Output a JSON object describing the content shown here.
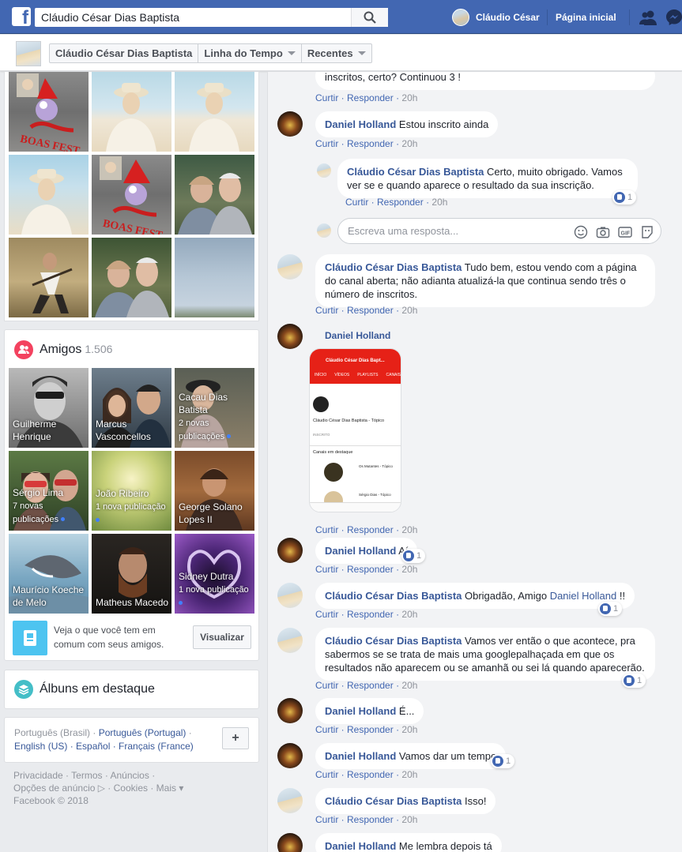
{
  "topbar": {
    "logo": "f",
    "search_value": "Cláudio César Dias Baptista",
    "user_name": "Cláudio César",
    "home_label": "Página inicial"
  },
  "subbar": {
    "crumbs": [
      "Cláudio César Dias Baptista",
      "Linha do Tempo",
      "Recentes"
    ]
  },
  "friends": {
    "title": "Amigos",
    "count": "1.506",
    "items": [
      {
        "name": "Guilherme Henrique",
        "sub": ""
      },
      {
        "name": "Marcus Vasconcellos",
        "sub": ""
      },
      {
        "name": "Cacau Dias Batista",
        "sub": "2 novas publicações"
      },
      {
        "name": "Sérgio Lima",
        "sub": "7 novas publicações"
      },
      {
        "name": "João Ribeiro",
        "sub": "1 nova publicação"
      },
      {
        "name": "George Solano Lopes II",
        "sub": ""
      },
      {
        "name": "Maurício Koeche de Melo",
        "sub": ""
      },
      {
        "name": "Matheus Macedo",
        "sub": ""
      },
      {
        "name": "Sidney Dutra",
        "sub": "1 nova publicação"
      }
    ],
    "mutual_text": "Veja o que você tem em comum com seus amigos.",
    "mutual_button": "Visualizar"
  },
  "albums": {
    "title": "Álbuns em destaque"
  },
  "languages": {
    "line1": "Português (Brasil) · ",
    "line1_link": "Português (Portugal)",
    "line1_sep": " ·",
    "line2": "English (US) · Español · Français (France)",
    "add": "+"
  },
  "footer": {
    "line1": "Privacidade · Termos · Anúncios ·",
    "line2": "Opções de anúncio ▷ · Cookies · Mais ▾",
    "line3": "Facebook © 2018"
  },
  "comments": {
    "c0": {
      "text": "inscritos, certo? Continuou 3 !",
      "like": "Curtir",
      "reply": "Responder",
      "time": "20h"
    },
    "c1": {
      "author": "Daniel Holland",
      "text": " Estou inscrito ainda",
      "like": "Curtir",
      "reply": "Responder",
      "time": "20h"
    },
    "c2": {
      "author": "Cláudio César Dias Baptista",
      "text": " Certo, muito obrigado. Vamos ver se e quando aparece o resultado da sua inscrição.",
      "like": "Curtir",
      "reply": "Responder",
      "time": "20h",
      "reactions": "1"
    },
    "reply_placeholder": "Escreva uma resposta...",
    "c3": {
      "author": "Cláudio César Dias Baptista",
      "text": " Tudo bem, estou vendo com a página do canal aberta; não adianta atualizá-la que continua sendo três o número de inscritos.",
      "like": "Curtir",
      "reply": "Responder",
      "time": "20h"
    },
    "c4": {
      "author": "Daniel Holland",
      "like": "Curtir",
      "reply": "Responder",
      "time": "20h"
    },
    "c5": {
      "author": "Daniel Holland",
      "text": " Aí",
      "like": "Curtir",
      "reply": "Responder",
      "time": "20h",
      "reactions": "1"
    },
    "c6": {
      "author": "Cláudio César Dias Baptista",
      "text": " Obrigadão, Amigo ",
      "mention": "Daniel Holland",
      "text2": " !!",
      "like": "Curtir",
      "reply": "Responder",
      "time": "20h",
      "reactions": "1"
    },
    "c7": {
      "author": "Cláudio César Dias Baptista",
      "text": " Vamos ver então o que acontece, pra sabermos se se trata de mais uma googlepalhaçada em que os resultados não aparecem ou se amanhã ou sei lá quando aparecerão.",
      "like": "Curtir",
      "reply": "Responder",
      "time": "20h",
      "reactions": "1"
    },
    "c8": {
      "author": "Daniel Holland",
      "text": " É...",
      "like": "Curtir",
      "reply": "Responder",
      "time": "20h"
    },
    "c9": {
      "author": "Daniel Holland",
      "text": " Vamos dar um tempo",
      "like": "Curtir",
      "reply": "Responder",
      "time": "20h",
      "reactions": "1"
    },
    "c10": {
      "author": "Cláudio César Dias Baptista",
      "text": " Isso!",
      "like": "Curtir",
      "reply": "Responder",
      "time": "20h"
    },
    "c11": {
      "author": "Daniel Holland",
      "text": " Me lembra depois tá"
    }
  },
  "screenshot_attachment": {
    "header": "Cláudio César Dias Bapt...",
    "tabs": [
      "INÍCIO",
      "VÍDEOS",
      "PLAYLISTS",
      "CANAIS"
    ],
    "channel_name": "Cláudio César Dias Baptista - Tópico",
    "subscribed": "INSCRITO",
    "featured": "Canais em destaque",
    "ch1": "Os Mutantes - Tópico",
    "ch2": "Sérgio Dias - Tópico"
  },
  "colors": {
    "brand": "#4267b2",
    "link": "#385898",
    "background": "#e9ebee"
  }
}
